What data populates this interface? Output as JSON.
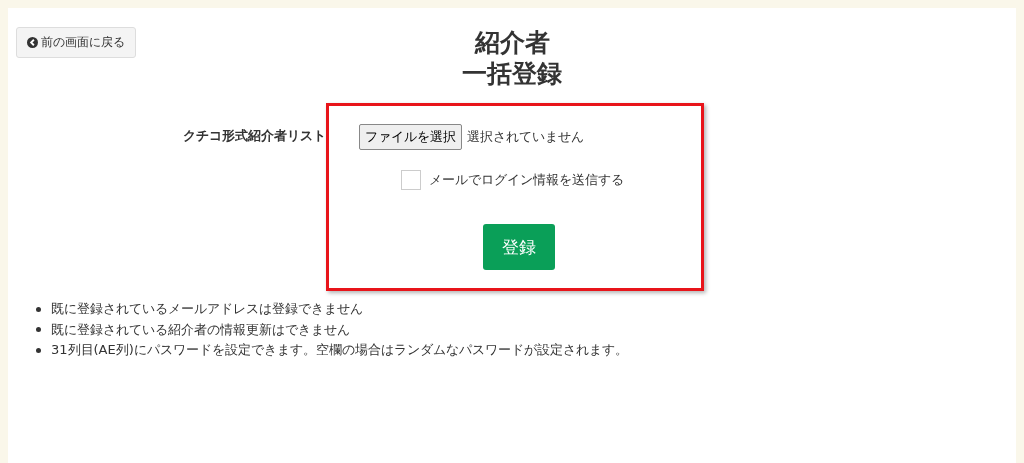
{
  "back_button": {
    "label": "前の画面に戻る"
  },
  "title": [
    "紹介者",
    "一括登録"
  ],
  "form": {
    "label": "クチコ形式紹介者リスト",
    "file_button": "ファイルを選択",
    "file_status": "選択されていません",
    "send_mail": {
      "label": "メールでログイン情報を送信する",
      "checked": false
    },
    "submit": "登録",
    "highlighted": true
  },
  "notes": [
    "既に登録されているメールアドレスは登録できません",
    "既に登録されている紹介者の情報更新はできません",
    "31列目(AE列)にパスワードを設定できます。空欄の場合はランダムなパスワードが設定されます。"
  ]
}
